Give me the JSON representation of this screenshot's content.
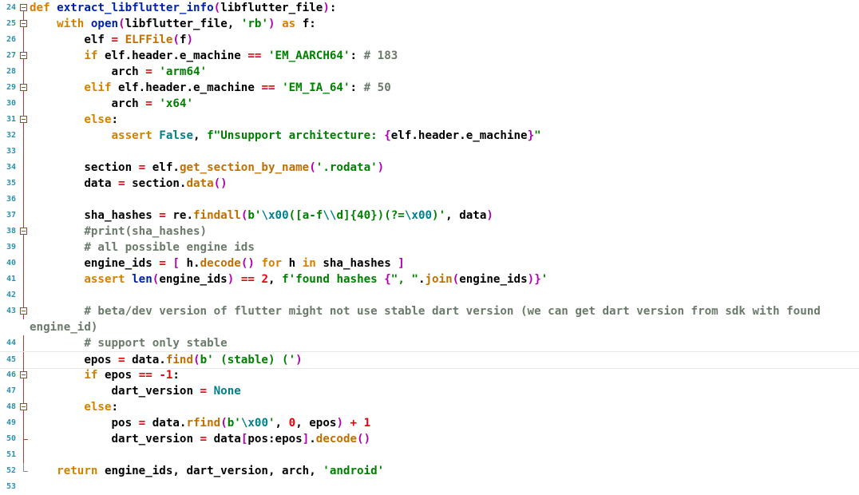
{
  "editor": {
    "lines": [
      {
        "n": "24",
        "fold": "box",
        "html": "<span class='k'>def</span> <span class='f'>extract_libflutter_info</span><span class='br'>(</span>libflutter_file<span class='br'>)</span>:"
      },
      {
        "n": "25",
        "fold": "box",
        "html": "    <span class='k'>with</span> <span class='f'>open</span><span class='br'>(</span>libflutter_file, <span class='s'>'rb'</span><span class='br'>)</span> <span class='k'>as</span> f:"
      },
      {
        "n": "26",
        "fold": "line",
        "html": "        elf <span class='n'>=</span> <span class='mth'>ELFFile</span><span class='br'>(</span>f<span class='br'>)</span>"
      },
      {
        "n": "27",
        "fold": "box",
        "html": "        <span class='k'>if</span> elf.header.e_machine <span class='n'>==</span> <span class='s'>'EM_AARCH64'</span>: <span class='c'># 183</span>"
      },
      {
        "n": "28",
        "fold": "line",
        "html": "            arch <span class='n'>=</span> <span class='s'>'arm64'</span>"
      },
      {
        "n": "29",
        "fold": "box",
        "html": "        <span class='k'>elif</span> elf.header.e_machine <span class='n'>==</span> <span class='s'>'EM_IA_64'</span>: <span class='c'># 50</span>"
      },
      {
        "n": "30",
        "fold": "line",
        "html": "            arch <span class='n'>=</span> <span class='s'>'x64'</span>"
      },
      {
        "n": "31",
        "fold": "box",
        "html": "        <span class='k'>else</span>:"
      },
      {
        "n": "32",
        "fold": "line",
        "html": "            <span class='k'>assert</span> <span class='b'>False</span>, <span class='s'>f\"Unsupport architecture: </span><span class='br'>{</span>elf.header.e_machine<span class='br'>}</span><span class='s'>\"</span>"
      },
      {
        "n": "33",
        "fold": "line",
        "html": ""
      },
      {
        "n": "34",
        "fold": "line",
        "html": "        section <span class='n'>=</span> elf.<span class='mth'>get_section_by_name</span><span class='br'>(</span><span class='s'>'.rodata'</span><span class='br'>)</span>"
      },
      {
        "n": "35",
        "fold": "line",
        "html": "        data <span class='n'>=</span> section.<span class='mth'>data</span><span class='br'>()</span>"
      },
      {
        "n": "36",
        "fold": "line",
        "html": ""
      },
      {
        "n": "37",
        "fold": "line",
        "html": "        sha_hashes <span class='n'>=</span> re.<span class='mth'>findall</span><span class='br'>(</span><span class='s'>b'</span><span class='b'>\\x00</span><span class='s'>([a-f</span><span class='b'>\\\\</span><span class='s'>d]{40})(?=</span><span class='b'>\\x00</span><span class='s'>)'</span>, data<span class='br'>)</span>"
      },
      {
        "n": "38",
        "fold": "box",
        "html": "        <span class='c'>#print(sha_hashes)</span>"
      },
      {
        "n": "39",
        "fold": "line",
        "html": "        <span class='c'># all possible engine ids</span>"
      },
      {
        "n": "40",
        "fold": "line",
        "html": "        engine_ids <span class='n'>=</span> <span class='br'>[</span> h.<span class='mth'>decode</span><span class='br'>()</span> <span class='k'>for</span> h <span class='k'>in</span> sha_hashes <span class='br'>]</span>"
      },
      {
        "n": "41",
        "fold": "line",
        "html": "        <span class='k'>assert</span> <span class='f'>len</span><span class='br'>(</span>engine_ids<span class='br'>)</span> <span class='n'>==</span> <span class='n'>2</span>, <span class='s'>f'found hashes </span><span class='br'>{</span><span class='s'>\", \"</span>.<span class='mth'>join</span><span class='br'>(</span>engine_ids<span class='br'>)</span><span class='br'>}</span><span class='s'>'</span>"
      },
      {
        "n": "42",
        "fold": "line",
        "html": ""
      },
      {
        "n": "43",
        "fold": "box",
        "html": "        <span class='c'># beta/dev version of flutter might not use stable dart version (we can get dart version from sdk with found</span>",
        "wrap": "<span class='c'>engine_id)</span>"
      },
      {
        "n": "44",
        "fold": "line",
        "html": "        <span class='c'># support only stable</span>"
      },
      {
        "n": "45",
        "fold": "line",
        "cur": true,
        "html": "        epos <span class='n'>=</span> data.<span class='mth'>find</span><span class='br'>(</span><span class='s'>b' (stable) ('</span><span class='br'>)</span>"
      },
      {
        "n": "46",
        "fold": "box",
        "html": "        <span class='k'>if</span> epos <span class='n'>==</span> <span class='n'>-1</span>:"
      },
      {
        "n": "47",
        "fold": "line",
        "html": "            dart_version <span class='n'>=</span> <span class='b'>None</span>"
      },
      {
        "n": "48",
        "fold": "box",
        "html": "        <span class='k'>else</span>:"
      },
      {
        "n": "49",
        "fold": "line",
        "html": "            pos <span class='n'>=</span> data.<span class='mth'>rfind</span><span class='br'>(</span><span class='s'>b'</span><span class='b'>\\x00</span><span class='s'>'</span>, <span class='n'>0</span>, epos<span class='br'>)</span> <span class='n'>+</span> <span class='n'>1</span>"
      },
      {
        "n": "50",
        "fold": "end",
        "html": "            dart_version <span class='n'>=</span> data<span class='br'>[</span>pos:epos<span class='br'>]</span>.<span class='mth'>decode</span><span class='br'>()</span>"
      },
      {
        "n": "51",
        "fold": "line",
        "html": ""
      },
      {
        "n": "52",
        "fold": "endfinal",
        "html": "    <span class='k'>return</span> engine_ids, dart_version, arch, <span class='s'>'android'</span>"
      },
      {
        "n": "53",
        "fold": "none",
        "html": ""
      }
    ]
  }
}
